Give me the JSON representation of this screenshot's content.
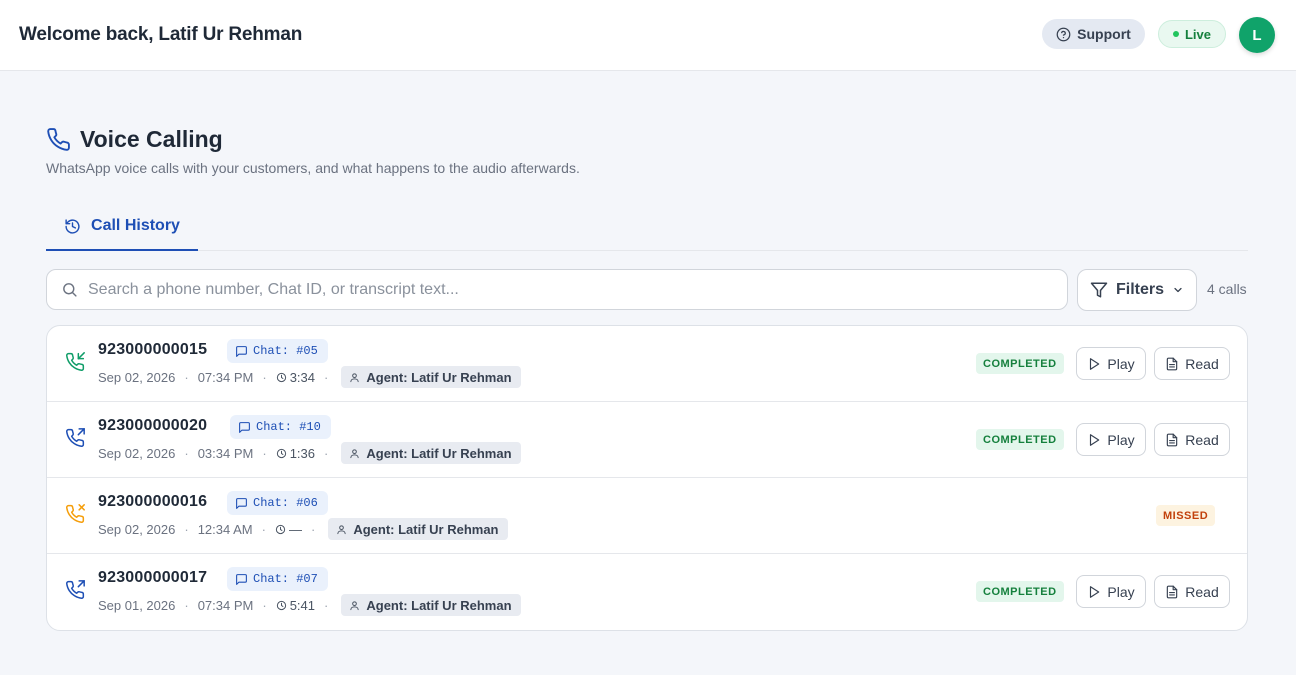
{
  "header": {
    "welcome": "Welcome back, Latif Ur Rehman",
    "support_label": "Support",
    "live_label": "Live",
    "avatar_initial": "L"
  },
  "page": {
    "title": "Voice Calling",
    "subtitle": "WhatsApp voice calls with your customers, and what happens to the audio afterwards."
  },
  "tabs": [
    {
      "label": "Call History",
      "active": true
    }
  ],
  "search": {
    "placeholder": "Search a phone number, Chat ID, or transcript text..."
  },
  "filters": {
    "label": "Filters"
  },
  "count_label": "4 calls",
  "colors": {
    "accent": "#1e4fb5",
    "completed": "#15803d",
    "missed": "#c2410c",
    "incoming_icon": "#0f9d68",
    "outgoing_icon": "#1e4fb5",
    "missed_icon": "#f59e0b"
  },
  "calls": [
    {
      "phone": "923000000015",
      "chat": "Chat: #05",
      "date": "Sep 02, 2026",
      "time": "07:34 PM",
      "duration": "3:34",
      "agent": "Agent: Latif Ur Rehman",
      "status": "COMPLETED",
      "direction_icon": "phone-incoming-icon",
      "actions": {
        "play": "Play",
        "read": "Read"
      }
    },
    {
      "phone": "923000000020",
      "chat": "Chat: #10",
      "date": "Sep 02, 2026",
      "time": "03:34 PM",
      "duration": "1:36",
      "agent": "Agent: Latif Ur Rehman",
      "status": "COMPLETED",
      "direction_icon": "phone-outgoing-icon",
      "actions": {
        "play": "Play",
        "read": "Read"
      }
    },
    {
      "phone": "923000000016",
      "chat": "Chat: #06",
      "date": "Sep 02, 2026",
      "time": "12:34 AM",
      "duration": "—",
      "agent": "Agent: Latif Ur Rehman",
      "status": "MISSED",
      "direction_icon": "phone-missed-icon"
    },
    {
      "phone": "923000000017",
      "chat": "Chat: #07",
      "date": "Sep 01, 2026",
      "time": "07:34 PM",
      "duration": "5:41",
      "agent": "Agent: Latif Ur Rehman",
      "status": "COMPLETED",
      "direction_icon": "phone-outgoing-icon",
      "actions": {
        "play": "Play",
        "read": "Read"
      }
    }
  ]
}
